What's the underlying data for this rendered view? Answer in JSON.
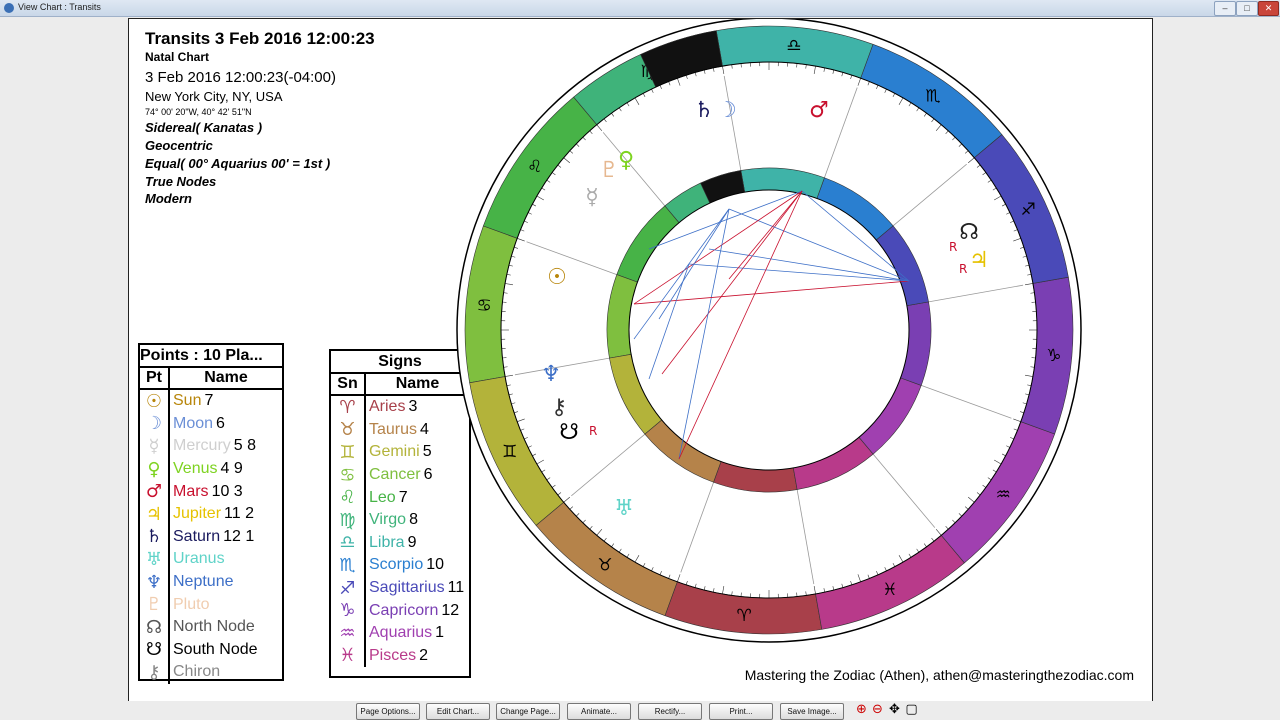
{
  "window": {
    "title": "View Chart : Transits",
    "min": "–",
    "max": "□",
    "close": "✕"
  },
  "header": {
    "title": "Transits 3 Feb 2016 12:00:23",
    "subtitle": "Natal Chart",
    "date": "3 Feb 2016 12:00:23(-04:00)",
    "location": "New York City, NY, USA",
    "coords": "74° 00' 20\"W, 40° 42' 51\"N",
    "zodiac": "Sidereal( Kanatas )",
    "centric": "Geocentric",
    "houses": "Equal( 00° Aquarius 00' = 1st )",
    "nodes": "True Nodes",
    "style": "Modern"
  },
  "points_table": {
    "caption": "Points : 10 Pla...",
    "col_pt": "Pt",
    "col_name": "Name",
    "rows": [
      {
        "glyph": "☉",
        "name": "Sun",
        "value": "7",
        "color": "#b8860b"
      },
      {
        "glyph": "☽",
        "name": "Moon",
        "value": "6",
        "color": "#6b8fd6"
      },
      {
        "glyph": "☿",
        "name": "Mercury",
        "value": "5 8",
        "color": "#cfcfcf"
      },
      {
        "glyph": "♀",
        "name": "Venus",
        "value": "4  9",
        "color": "#7ed321"
      },
      {
        "glyph": "♂",
        "name": "Mars",
        "value": "10 3",
        "color": "#c8102e"
      },
      {
        "glyph": "♃",
        "name": "Jupiter",
        "value": "11  2",
        "color": "#e6c200"
      },
      {
        "glyph": "♄",
        "name": "Saturn",
        "value": "12  1",
        "color": "#1a1a5e"
      },
      {
        "glyph": "♅",
        "name": "Uranus",
        "value": "",
        "color": "#5fd3c8"
      },
      {
        "glyph": "♆",
        "name": "Neptune",
        "value": "",
        "color": "#3d6fc7"
      },
      {
        "glyph": "♇",
        "name": "Pluto",
        "value": "",
        "color": "#f0cdb0"
      },
      {
        "glyph": "☊",
        "name": "North Node",
        "value": "",
        "color": "#555555"
      },
      {
        "glyph": "☋",
        "name": "South Node",
        "value": "",
        "color": "#000000"
      },
      {
        "glyph": "⚷",
        "name": "Chiron",
        "value": "",
        "color": "#888888"
      }
    ]
  },
  "signs_table": {
    "caption": "Signs",
    "col_sn": "Sn",
    "col_name": "Name",
    "rows": [
      {
        "glyph": "♈",
        "name": "Aries",
        "value": "3",
        "color": "#a8404a"
      },
      {
        "glyph": "♉",
        "name": "Taurus",
        "value": "4",
        "color": "#b5834a"
      },
      {
        "glyph": "♊",
        "name": "Gemini",
        "value": "5",
        "color": "#b3b33a"
      },
      {
        "glyph": "♋",
        "name": "Cancer",
        "value": "6",
        "color": "#7fbf3f"
      },
      {
        "glyph": "♌",
        "name": "Leo",
        "value": "7",
        "color": "#47b347"
      },
      {
        "glyph": "♍",
        "name": "Virgo",
        "value": "8",
        "color": "#3fb37a"
      },
      {
        "glyph": "♎",
        "name": "Libra",
        "value": "9",
        "color": "#3fb3a8"
      },
      {
        "glyph": "♏",
        "name": "Scorpio",
        "value": "10",
        "color": "#2a7fd0"
      },
      {
        "glyph": "♐",
        "name": "Sagittarius",
        "value": "11",
        "color": "#4a4ab8"
      },
      {
        "glyph": "♑",
        "name": "Capricorn",
        "value": "12",
        "color": "#7a3fb3"
      },
      {
        "glyph": "♒",
        "name": "Aquarius",
        "value": "1",
        "color": "#a040b0"
      },
      {
        "glyph": "♓",
        "name": "Pisces",
        "value": "2",
        "color": "#b83a8a"
      }
    ]
  },
  "footer": "Mastering the Zodiac (Athen), athen@masteringthezodiac.com",
  "buttons": [
    "Page Options...",
    "Edit Chart...",
    "Change Page...",
    "Animate...",
    "Rectify...",
    "Print...",
    "Save Image..."
  ],
  "zoom_icons": [
    "zoom-in-icon",
    "zoom-out-icon",
    "pan-icon",
    "fit-icon"
  ],
  "wheel": {
    "outer_signs": [
      "♏",
      "♎",
      "♍",
      "♌",
      "♋",
      "♊",
      "♉",
      "♈",
      "♓",
      "♒",
      "♑",
      "♐"
    ],
    "house_sign_colors": [
      "#2a7fd0",
      "#3fb3a8",
      "#3fb37a",
      "#47b347",
      "#7fbf3f",
      "#b3b33a",
      "#b5834a",
      "#a8404a",
      "#b83a8a",
      "#a040b0",
      "#7a3fb3",
      "#4a4ab8"
    ],
    "planets_outer": [
      {
        "glyph": "♄",
        "color": "#1a1a5e"
      },
      {
        "glyph": "☽",
        "color": "#6b8fd6"
      },
      {
        "glyph": "♂",
        "color": "#c8102e"
      },
      {
        "glyph": "☊",
        "color": "#222222"
      },
      {
        "glyph": "♃",
        "color": "#e6c200"
      },
      {
        "glyph": "♀",
        "color": "#7ed321"
      },
      {
        "glyph": "♇",
        "color": "#e6b890"
      },
      {
        "glyph": "☿",
        "color": "#aaaaaa"
      },
      {
        "glyph": "☉",
        "color": "#b8860b"
      },
      {
        "glyph": "♆",
        "color": "#3d6fc7"
      },
      {
        "glyph": "⚷",
        "color": "#333333"
      },
      {
        "glyph": "☋",
        "color": "#000000"
      },
      {
        "glyph": "♅",
        "color": "#5fd3c8"
      }
    ],
    "retro": "R"
  }
}
